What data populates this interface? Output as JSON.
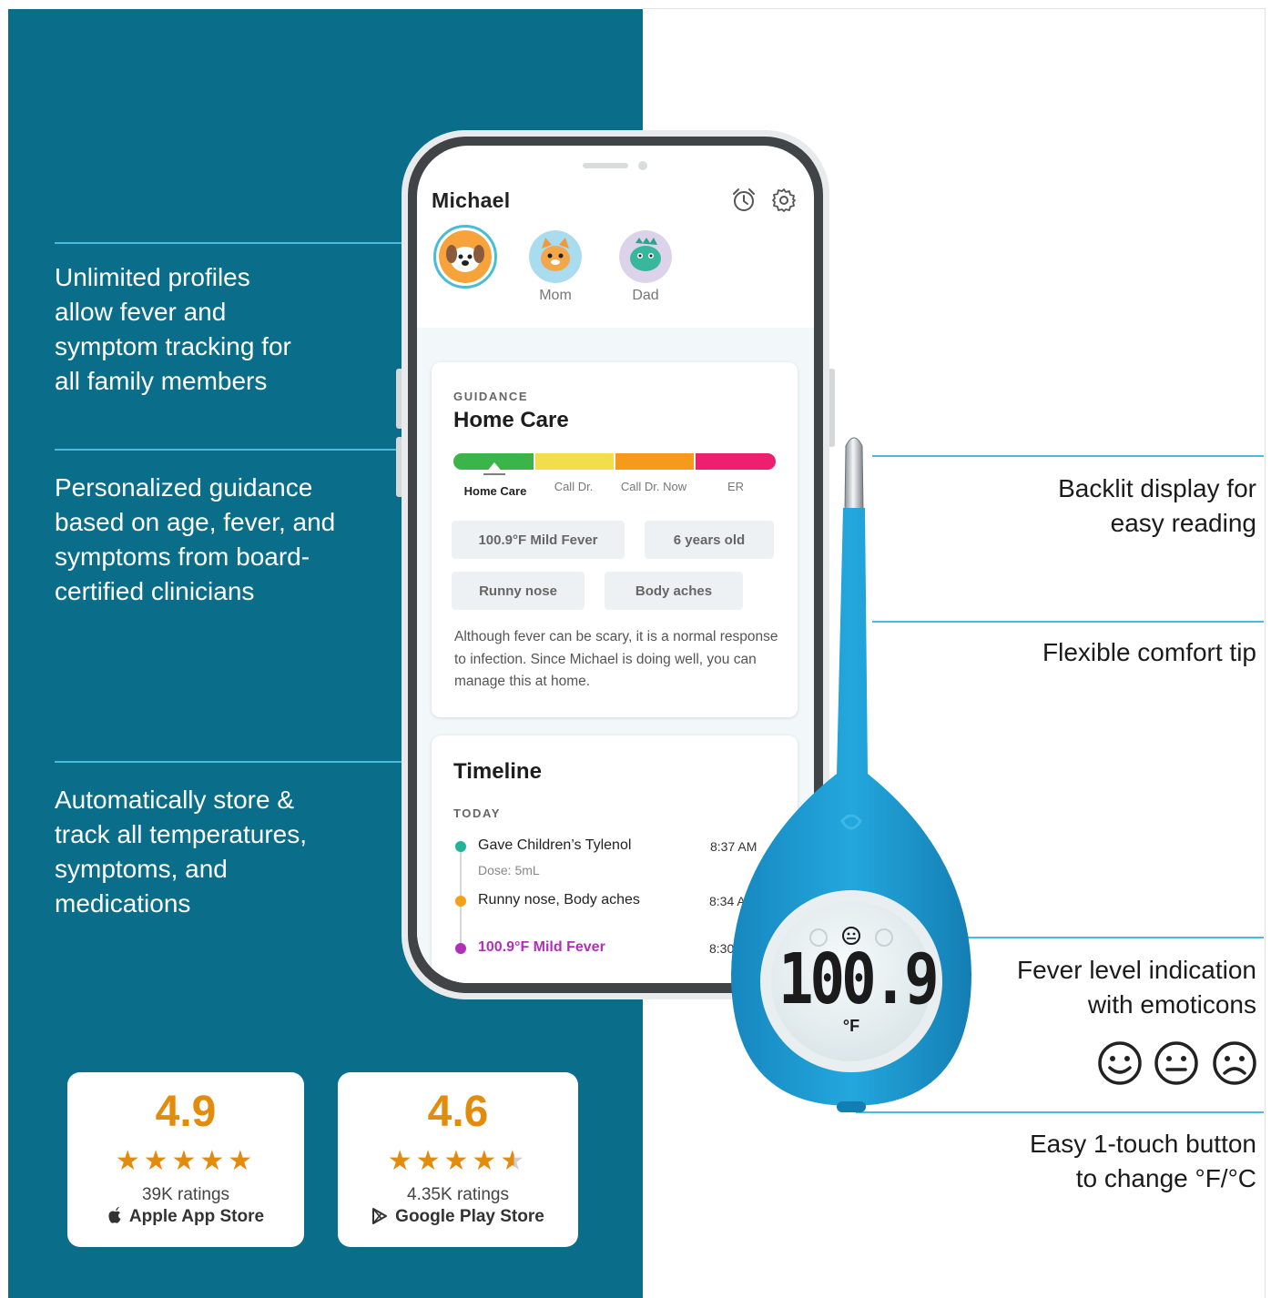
{
  "callouts_left": [
    "Unlimited profiles\nallow fever and\nsymptom tracking for\nall family members",
    "Personalized guidance\nbased on age, fever, and\nsymptoms from board-\ncertified clinicians",
    "Automatically store &\ntrack all temperatures,\nsymptoms, and\nmedications"
  ],
  "callouts_right": [
    "Backlit display for\neasy reading",
    "Flexible comfort tip",
    "Fever level indication\nwith emoticons",
    "Easy 1-touch button\nto change °F/°C"
  ],
  "app": {
    "user_name": "Michael",
    "header_icons": [
      "alarm-clock-icon",
      "gear-icon"
    ],
    "profiles": [
      {
        "label": "",
        "icon": "dog-avatar-icon"
      },
      {
        "label": "Mom",
        "icon": "cat-avatar-icon"
      },
      {
        "label": "Dad",
        "icon": "dino-avatar-icon"
      }
    ],
    "guidance": {
      "eyebrow": "GUIDANCE",
      "title": "Home Care",
      "bands": [
        "Home Care",
        "Call Dr.",
        "Call Dr. Now",
        "ER"
      ],
      "band_colors": [
        "#3bb54a",
        "#f2dd4a",
        "#f59a1a",
        "#ef1f6f"
      ],
      "chips": [
        "100.9°F Mild Fever",
        "6 years old",
        "Runny nose",
        "Body aches"
      ],
      "body": "Although fever can be scary, it is a normal response to infection. Since Michael is doing well, you can manage this at home."
    },
    "timeline": {
      "title": "Timeline",
      "eyebrow": "TODAY",
      "events": [
        {
          "text": "Gave Children’s Tylenol",
          "sub": "Dose: 5mL",
          "time": "8:37 AM",
          "color": "#22b39a"
        },
        {
          "text": "Runny nose, Body aches",
          "sub": "",
          "time": "8:34 AM",
          "color": "#f5a01a"
        },
        {
          "text": "100.9°F Mild Fever",
          "sub": "",
          "time": "8:30",
          "color": "#b030b8"
        }
      ]
    }
  },
  "thermometer": {
    "reading": "100.9",
    "unit": "°F",
    "emoticons": [
      "happy-face-icon",
      "neutral-face-icon",
      "sad-face-icon"
    ]
  },
  "ratings": [
    {
      "score": "4.9",
      "stars": "★★★★★",
      "count": "39K ratings",
      "store": "Apple App Store",
      "store_icon": "apple-icon"
    },
    {
      "score": "4.6",
      "stars": "★★★★",
      "count": "4.35K ratings",
      "store": "Google Play Store",
      "store_icon": "google-play-icon"
    }
  ],
  "colors": {
    "teal_bg": "#0a6e8a",
    "accent": "#49bdd6",
    "rating": "#e28b0c",
    "thermometer": "#1a9bd1"
  }
}
